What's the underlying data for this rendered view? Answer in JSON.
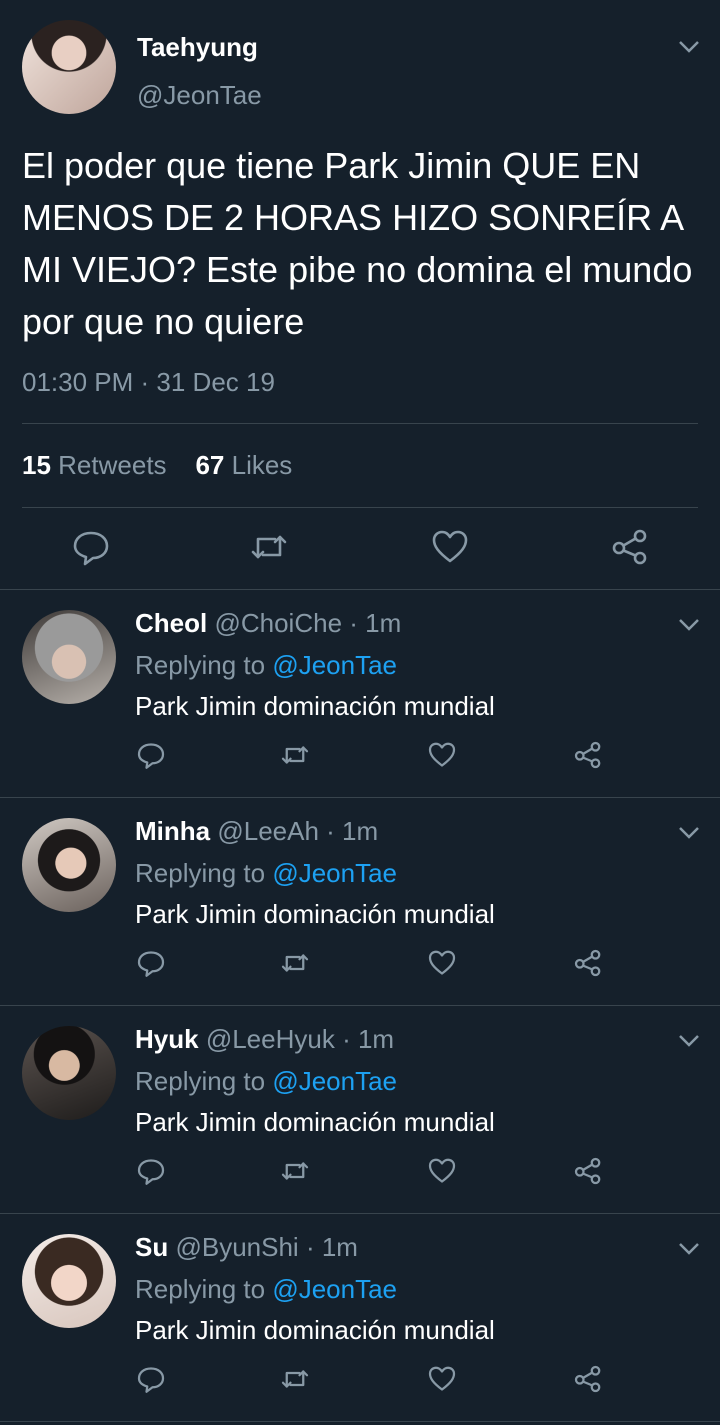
{
  "main": {
    "name": "Taehyung",
    "handle": "@JeonTae",
    "text": "El poder que tiene Park Jimin QUE EN MENOS DE 2 HORAS HIZO SONREÍR A MI VIEJO? Este pibe no domina el mundo por que no quiere",
    "time": "01:30 PM · 31 Dec 19",
    "retweets_count": "15",
    "retweets_label": "Retweets",
    "likes_count": "67",
    "likes_label": "Likes"
  },
  "replies": [
    {
      "name": "Cheol",
      "handle": "@ChoiChe",
      "time": "· 1m",
      "replying_label": "Replying to",
      "replying_to": "@JeonTae",
      "text": "Park Jimin dominación mundial"
    },
    {
      "name": "Minha",
      "handle": "@LeeAh",
      "time": "· 1m",
      "replying_label": "Replying to",
      "replying_to": "@JeonTae",
      "text": "Park Jimin dominación mundial"
    },
    {
      "name": "Hyuk",
      "handle": "@LeeHyuk",
      "time": "· 1m",
      "replying_label": "Replying to",
      "replying_to": "@JeonTae",
      "text": "Park Jimin dominación mundial"
    },
    {
      "name": "Su",
      "handle": "@ByunShi",
      "time": "· 1m",
      "replying_label": "Replying to",
      "replying_to": "@JeonTae",
      "text": "Park Jimin dominación mundial"
    }
  ],
  "icons": [
    "reply-icon",
    "retweet-icon",
    "like-icon",
    "share-icon",
    "chevron-down-icon"
  ],
  "colors": {
    "background": "#15202b",
    "muted": "#8899a6",
    "link": "#1da1f2",
    "divider": "#38444d"
  }
}
